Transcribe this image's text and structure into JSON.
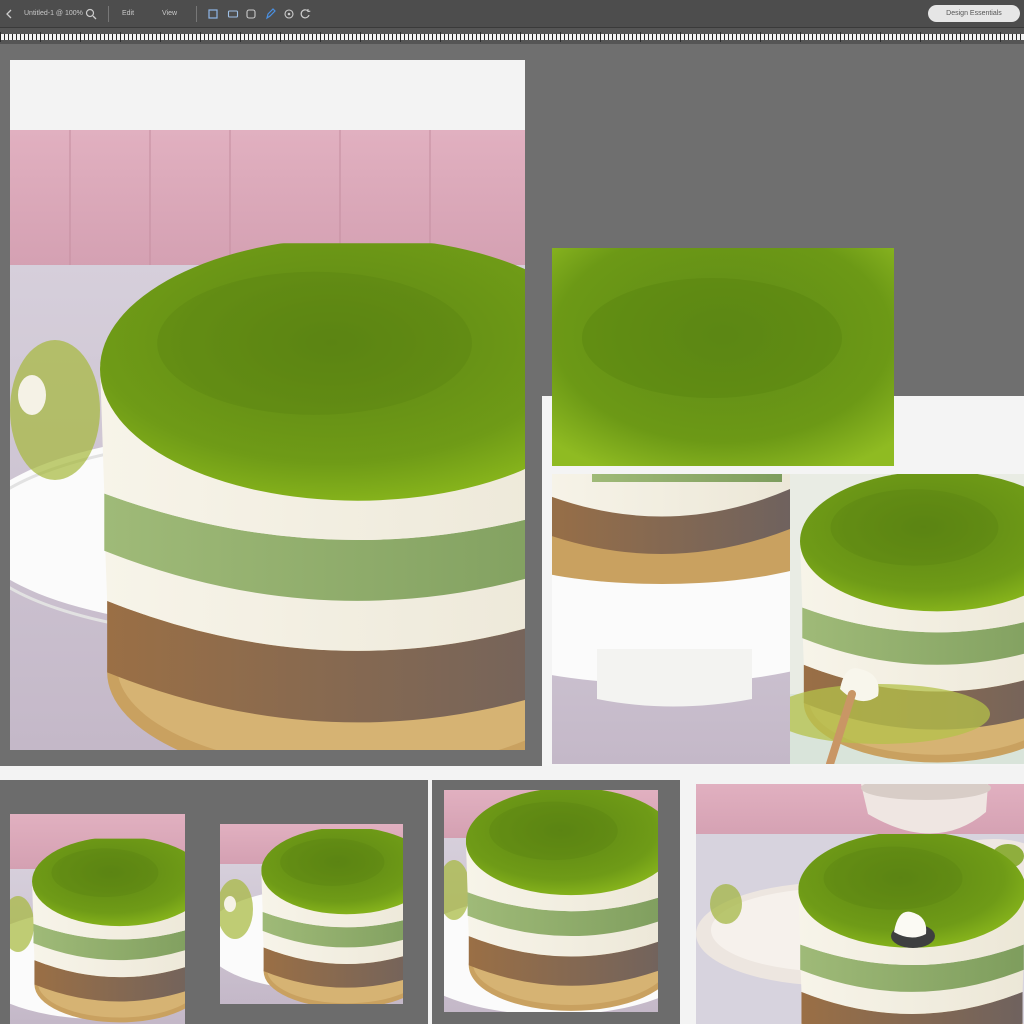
{
  "toolbar": {
    "doc_tab": "Untitled-1 @ 100%",
    "menu_a": "Edit",
    "menu_b": "View",
    "search_label": "Design Essentials"
  },
  "colors": {
    "matcha": "#7da91a",
    "matcha_dark": "#4f7612",
    "cream": "#f4f1e4",
    "sponge": "#8f6f52",
    "gold": "#c9a160",
    "wall": "#d8a7b7",
    "table": "#cac0cf",
    "plate": "#f6f6f4"
  },
  "icons": [
    "back-icon",
    "zoom-icon",
    "layers-icon",
    "link-icon",
    "brush-icon",
    "pen-icon",
    "refresh-icon",
    "history-icon"
  ]
}
